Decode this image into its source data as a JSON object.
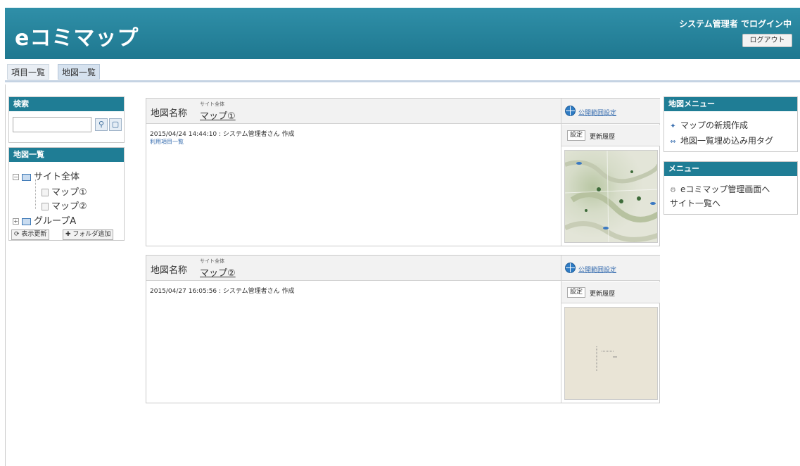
{
  "header": {
    "app_title": "eコミマップ",
    "login_status": "システム管理者 でログイン中",
    "logout_label": "ログアウト",
    "colors": {
      "header_bg": "#2589a2",
      "panel_head": "#1f7d95",
      "link": "#3a6fb0"
    }
  },
  "tabs": [
    {
      "label": "項目一覧"
    },
    {
      "label": "地図一覧"
    }
  ],
  "search": {
    "heading": "検索",
    "value": "",
    "search_icon": "magnifier-icon",
    "clear_icon": "clear-icon"
  },
  "tree": {
    "heading": "地図一覧",
    "root_label": "サイト全体",
    "maps": [
      "マップ①",
      "マップ②"
    ],
    "group_label": "グループA",
    "refresh_label": "表示更新",
    "add_folder_label": "フォルダ追加"
  },
  "maps": [
    {
      "label": "地図名称",
      "site": "サイト全体",
      "name": "マップ①",
      "info": "2015/04/24 14:44:10 : システム管理者さん 作成",
      "items_link": "利用項目一覧",
      "scope_label": "公開範囲設定",
      "settings_label": "設定",
      "history_label": "更新履歴"
    },
    {
      "label": "地図名称",
      "site": "サイト全体",
      "name": "マップ②",
      "info": "2015/04/27 16:05:56 : システム管理者さん 作成",
      "scope_label": "公開範囲設定",
      "settings_label": "設定",
      "history_label": "更新履歴"
    }
  ],
  "map_menu": {
    "heading": "地図メニュー",
    "items": [
      "マップの新規作成",
      "地図一覧埋め込み用タグ"
    ]
  },
  "main_menu": {
    "heading": "メニュー",
    "items": [
      "eコミマップ管理画面へ",
      "サイト一覧へ"
    ]
  }
}
